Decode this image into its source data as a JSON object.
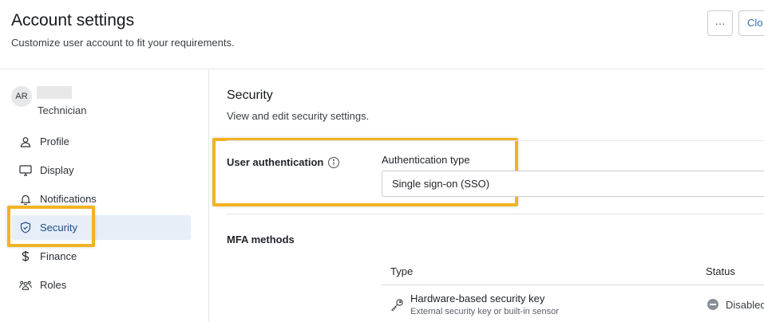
{
  "header": {
    "title": "Account settings",
    "subtitle": "Customize user account to fit your requirements.",
    "more_label": "···",
    "close_label": "Clo"
  },
  "user": {
    "initials": "AR",
    "role": "Technician"
  },
  "sidebar": {
    "items": [
      {
        "label": "Profile",
        "icon": "person-icon"
      },
      {
        "label": "Display",
        "icon": "monitor-icon"
      },
      {
        "label": "Notifications",
        "icon": "bell-icon"
      },
      {
        "label": "Security",
        "icon": "shield-icon",
        "active": true
      },
      {
        "label": "Finance",
        "icon": "dollar-icon"
      },
      {
        "label": "Roles",
        "icon": "users-icon"
      }
    ]
  },
  "security": {
    "title": "Security",
    "description": "View and edit security settings.",
    "user_auth_label": "User authentication",
    "auth_type_label": "Authentication type",
    "auth_type_value": "Single sign-on (SSO)",
    "mfa_label": "MFA methods",
    "table": {
      "columns": [
        "Type",
        "Status"
      ],
      "rows": [
        {
          "title": "Hardware-based security key",
          "subtitle": "External security key or built-in sensor",
          "status": "Disabled"
        }
      ]
    }
  },
  "colors": {
    "highlight": "#f0b323",
    "active_bg": "#e7eef7",
    "link": "#2f6fb0"
  }
}
